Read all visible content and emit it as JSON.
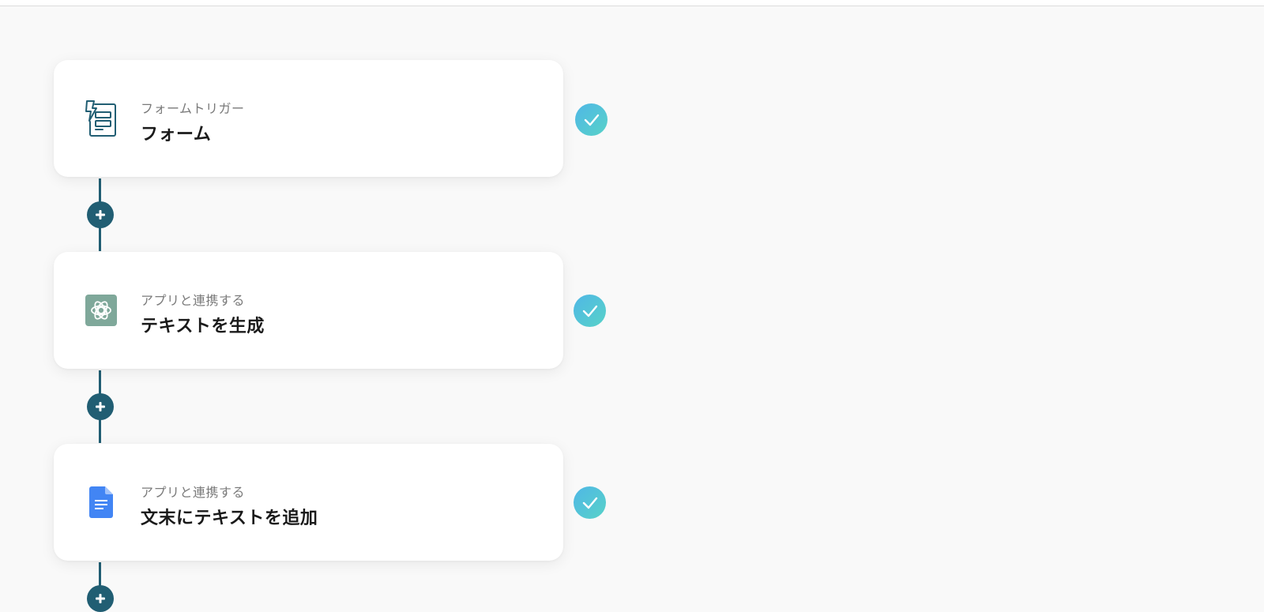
{
  "flow": {
    "steps": [
      {
        "type_label": "フォームトリガー",
        "title": "フォーム",
        "icon": "form-trigger-icon",
        "status": "completed"
      },
      {
        "type_label": "アプリと連携する",
        "title": "テキストを生成",
        "icon": "chatgpt-icon",
        "status": "completed"
      },
      {
        "type_label": "アプリと連携する",
        "title": "文末にテキストを追加",
        "icon": "google-docs-icon",
        "status": "completed"
      }
    ]
  },
  "colors": {
    "connector": "#215e73",
    "check_gradient_start": "#4fb7e6",
    "check_gradient_end": "#58d2c8",
    "form_icon": "#215e73",
    "chatgpt_bg": "#7fa89a",
    "docs_blue": "#4285f4"
  }
}
